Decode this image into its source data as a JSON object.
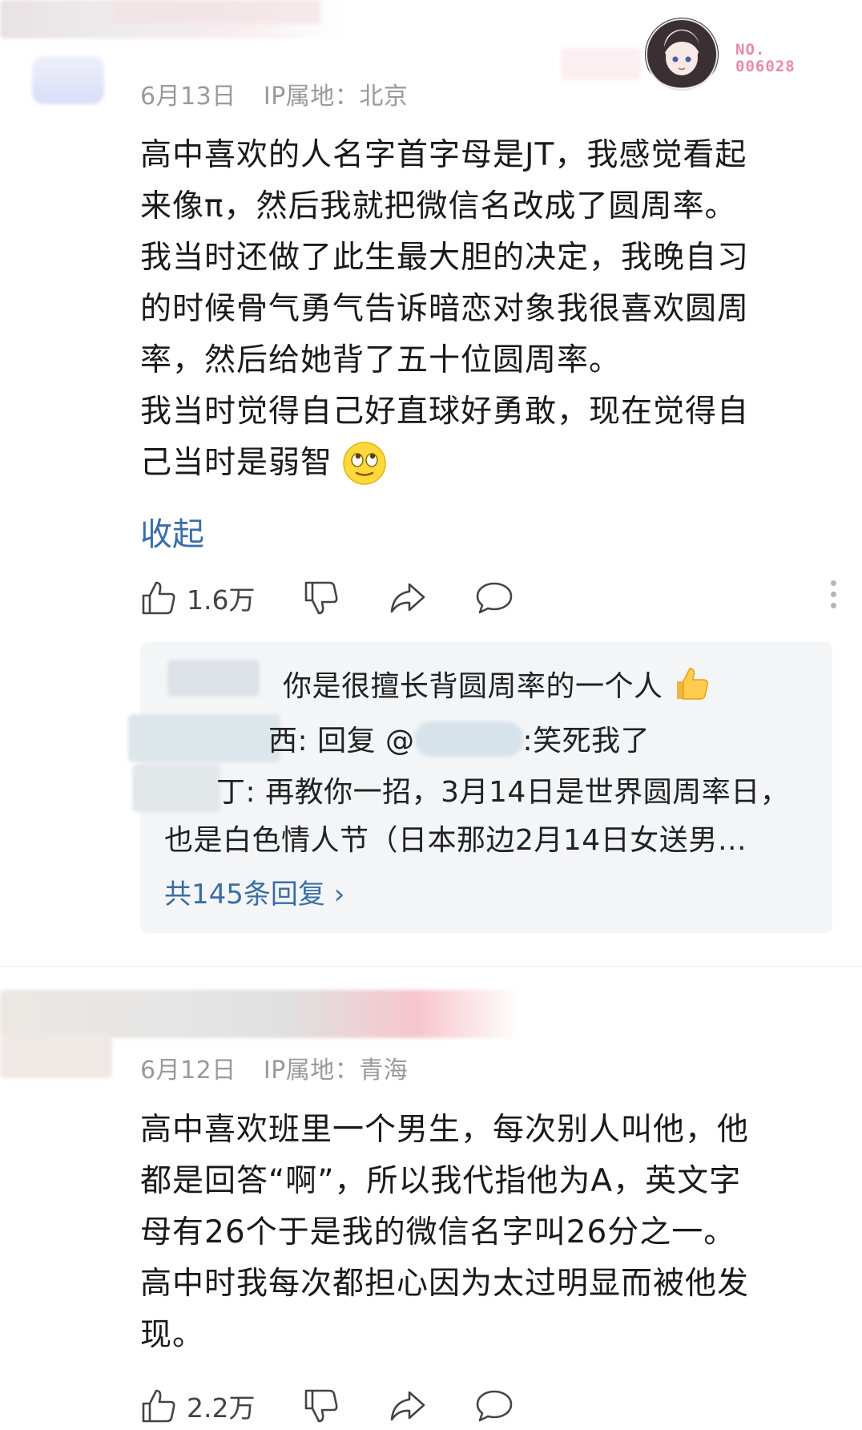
{
  "comments": [
    {
      "date": "6月13日",
      "ip_label": "IP属地：",
      "ip_location": "北京",
      "badge_line1": "NO.",
      "badge_line2": "006028",
      "lines": [
        "高中喜欢的人名字首字母是JT，我感觉看起",
        "来像π，然后我就把微信名改成了圆周率。",
        "我当时还做了此生最大胆的决定，我晚自习",
        "的时候骨气勇气告诉暗恋对象我很喜欢圆周",
        "率，然后给她背了五十位圆周率。",
        "我当时觉得自己好直球好勇敢，现在觉得自",
        "己当时是弱智"
      ],
      "collapse_label": "收起",
      "like_count": "1.6万",
      "replies": {
        "r1": "你是很擅长背圆周率的一个人",
        "r2_suffix": "西: 回复 @",
        "r2_tail": ":笑死我了",
        "r3_line1": "丁: 再教你一招，3月14日是世界圆周率日，",
        "r3_line2": "也是白色情人节（日本那边2月14日女送男…",
        "more_label": "共145条回复 ›"
      }
    },
    {
      "date": "6月12日",
      "ip_label": "IP属地：",
      "ip_location": "青海",
      "lines": [
        "高中喜欢班里一个男生，每次别人叫他，他",
        "都是回答“啊”，所以我代指他为A，英文字",
        "母有26个于是我的微信名字叫26分之一。",
        "高中时我每次都担心因为太过明显而被他发",
        "现。"
      ],
      "like_count": "2.2万"
    }
  ],
  "colors": {
    "link": "#3a6ea5",
    "meta": "#9a9a9a",
    "reply_bg": "#f4f5f7",
    "icon": "#444444"
  },
  "icons": [
    "thumbs-up-icon",
    "thumbs-down-icon",
    "share-icon",
    "comment-icon",
    "more-icon",
    "emoji-roll-eyes-icon",
    "thumbs-up-emoji-icon"
  ]
}
